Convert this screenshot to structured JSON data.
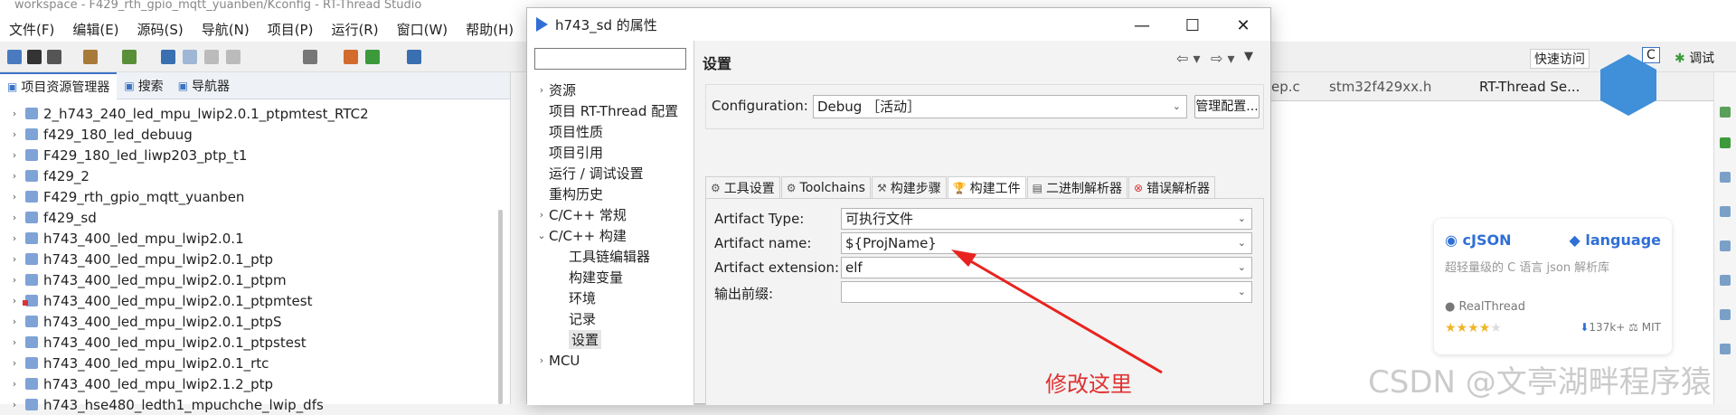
{
  "ide": {
    "title": "workspace - F429_rth_gpio_mqtt_yuanben/Kconfig - RT-Thread Studio",
    "menu": [
      "文件(F)",
      "编辑(E)",
      "源码(S)",
      "导航(N)",
      "项目(P)",
      "运行(R)",
      "窗口(W)",
      "帮助(H)"
    ],
    "quick_access": "快速访问",
    "perspective_c": "C",
    "perspective_debug": "调试"
  },
  "left_panel": {
    "tabs": [
      "项目资源管理器",
      "搜索",
      "导航器"
    ],
    "projects": [
      {
        "name": "2_h743_240_led_mpu_lwip2.0.1_ptpmtest_RTC2",
        "error": false
      },
      {
        "name": "f429_180_led_debuug",
        "error": false
      },
      {
        "name": "F429_180_led_liwp203_ptp_t1",
        "error": false
      },
      {
        "name": "f429_2",
        "error": false
      },
      {
        "name": "F429_rth_gpio_mqtt_yuanben",
        "error": false
      },
      {
        "name": "f429_sd",
        "error": false
      },
      {
        "name": "h743_400_led_mpu_lwip2.0.1",
        "error": false
      },
      {
        "name": "h743_400_led_mpu_lwip2.0.1_ptp",
        "error": false
      },
      {
        "name": "h743_400_led_mpu_lwip2.0.1_ptpm",
        "error": false
      },
      {
        "name": "h743_400_led_mpu_lwip2.0.1_ptpmtest",
        "error": true
      },
      {
        "name": "h743_400_led_mpu_lwip2.0.1_ptpS",
        "error": false
      },
      {
        "name": "h743_400_led_mpu_lwip2.0.1_ptpstest",
        "error": false
      },
      {
        "name": "h743_400_led_mpu_lwip2.0.1_rtc",
        "error": false
      },
      {
        "name": "h743_400_led_mpu_lwip2.1.2_ptp",
        "error": false
      },
      {
        "name": "h743_hse480_ledth1_mpuchche_lwip_dfs",
        "error": false
      }
    ]
  },
  "editor_tabs": [
    "ep.c",
    "stm32f429xx.h",
    "RT-Thread Se..."
  ],
  "dialog": {
    "title": "h743_sd 的属性",
    "nav": [
      {
        "label": "资源",
        "arrow": "›",
        "indent": 0
      },
      {
        "label": "项目 RT-Thread 配置",
        "arrow": "",
        "indent": 0
      },
      {
        "label": "项目性质",
        "arrow": "",
        "indent": 0
      },
      {
        "label": "项目引用",
        "arrow": "",
        "indent": 0
      },
      {
        "label": "运行 / 调试设置",
        "arrow": "",
        "indent": 0
      },
      {
        "label": "重构历史",
        "arrow": "",
        "indent": 0
      },
      {
        "label": "C/C++ 常规",
        "arrow": "›",
        "indent": 0
      },
      {
        "label": "C/C++ 构建",
        "arrow": "⌄",
        "indent": 0
      },
      {
        "label": "工具链编辑器",
        "arrow": "",
        "indent": 1
      },
      {
        "label": "构建变量",
        "arrow": "",
        "indent": 1
      },
      {
        "label": "环境",
        "arrow": "",
        "indent": 1
      },
      {
        "label": "记录",
        "arrow": "",
        "indent": 1
      },
      {
        "label": "设置",
        "arrow": "",
        "indent": 1,
        "selected": true
      },
      {
        "label": "MCU",
        "arrow": "›",
        "indent": 0
      }
    ],
    "settings_title": "设置",
    "configuration_label": "Configuration:",
    "configuration_value": "Debug ［活动］",
    "manage_button": "管理配置...",
    "tabs": [
      "工具设置",
      "Toolchains",
      "构建步骤",
      "构建工件",
      "二进制解析器",
      "错误解析器"
    ],
    "active_tab": "构建工件",
    "fields": [
      {
        "label": "Artifact Type:",
        "value": "可执行文件"
      },
      {
        "label": "Artifact name:",
        "value": "${ProjName}"
      },
      {
        "label": "Artifact extension:",
        "value": "elf"
      },
      {
        "label": "输出前缀:",
        "value": ""
      }
    ]
  },
  "annotation": "修改这里",
  "card": {
    "repo": "cJSON",
    "tag": "language",
    "description": "超轻量级的 C 语言 json 解析库",
    "org": "RealThread",
    "downloads": "137k+",
    "license": "MIT",
    "stars": 4
  },
  "watermark": "CSDN @文亭湖畔程序猿",
  "colors": {
    "accent": "#3b73c4",
    "arrow": "#e8231f",
    "card_link": "#2f6fd6"
  }
}
